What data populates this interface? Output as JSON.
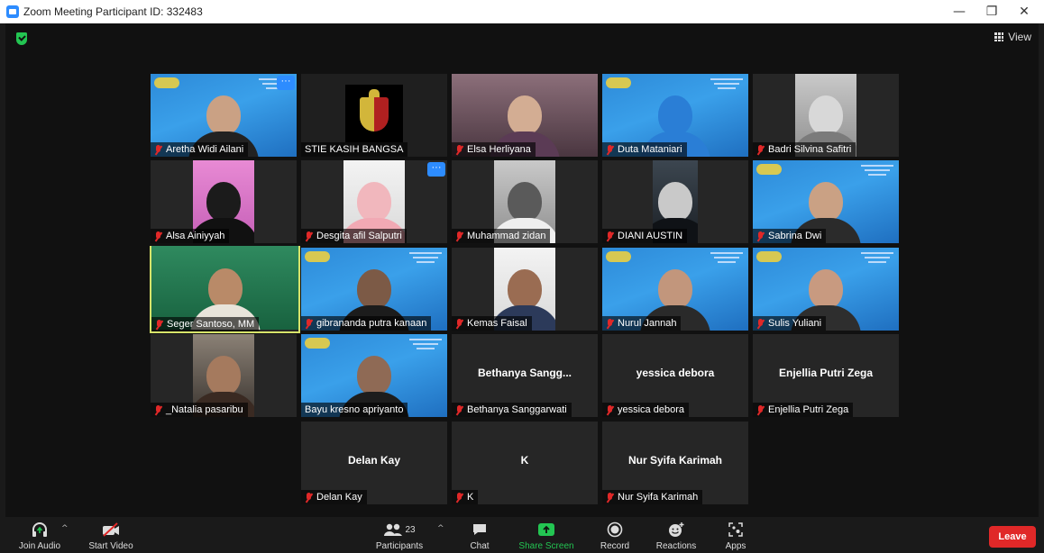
{
  "window": {
    "title": "Zoom Meeting Participant ID: 332483",
    "minimize": "—",
    "restore": "❐",
    "close": "✕"
  },
  "header": {
    "view_label": "View"
  },
  "tiles": [
    {
      "label": "Aretha Widi Ailani"
    },
    {
      "label": "STIE KASIH BANGSA"
    },
    {
      "label": "Elsa Herliyana"
    },
    {
      "label": "Duta Mataniari"
    },
    {
      "label": "Badri Silvina Safitri"
    },
    {
      "label": "Alsa Ainiyyah"
    },
    {
      "label": "Desgita afil Salputri"
    },
    {
      "label": "Muhammad zidan"
    },
    {
      "label": "DIANI AUSTIN"
    },
    {
      "label": "Sabrina Dwi"
    },
    {
      "label": "Seger Santoso, MM"
    },
    {
      "label": "gibrananda putra kanaan"
    },
    {
      "label": "Kemas Faisal"
    },
    {
      "label": "Nurul Jannah"
    },
    {
      "label": "Sulis Yuliani"
    },
    {
      "label": "_Natalia pasaribu"
    },
    {
      "label": "Bayu kresno apriyanto"
    },
    {
      "label": "Bethanya Sanggarwati",
      "display": "Bethanya  Sangg..."
    },
    {
      "label": "yessica debora",
      "display": "yessica debora"
    },
    {
      "label": "Enjellia Putri Zega",
      "display": "Enjellia Putri Zega"
    },
    {
      "label": "Delan Kay",
      "display": "Delan Kay"
    },
    {
      "label": "K",
      "display": "K"
    },
    {
      "label": "Nur Syifa Karimah",
      "display": "Nur Syifa Karimah"
    }
  ],
  "toolbar": {
    "join_audio": "Join Audio",
    "start_video": "Start Video",
    "participants": "Participants",
    "participant_count": "23",
    "chat": "Chat",
    "share_screen": "Share Screen",
    "record": "Record",
    "reactions": "Reactions",
    "apps": "Apps",
    "leave": "Leave",
    "caret": "^"
  },
  "colors": {
    "accent": "#2d8cff",
    "leave": "#e02828",
    "share": "#23c552",
    "active_speaker": "#d7e36a"
  }
}
